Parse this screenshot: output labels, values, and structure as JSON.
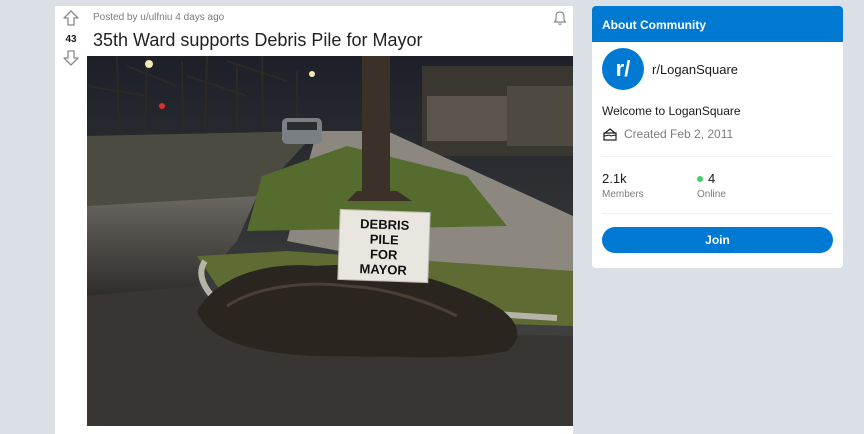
{
  "post": {
    "votes": "43",
    "meta": "Posted by u/ulfniu 4 days ago",
    "title": "35th Ward supports Debris Pile for Mayor",
    "image": {
      "sign_lines": [
        "DEBRIS",
        "PILE",
        "FOR",
        "MAYOR"
      ]
    }
  },
  "sidebar": {
    "header": "About Community",
    "avatar_text": "r/",
    "name": "r/LoganSquare",
    "description": "Welcome to LoganSquare",
    "created": "Created Feb 2, 2011",
    "members": {
      "value": "2.1k",
      "label": "Members"
    },
    "online": {
      "value": "4",
      "label": "Online"
    },
    "join_label": "Join"
  },
  "colors": {
    "accent": "#0079d3",
    "online": "#46d160",
    "page_bg": "#dae0e6"
  },
  "icons": [
    "upvote-icon",
    "downvote-icon",
    "bell-icon",
    "cake-icon"
  ]
}
